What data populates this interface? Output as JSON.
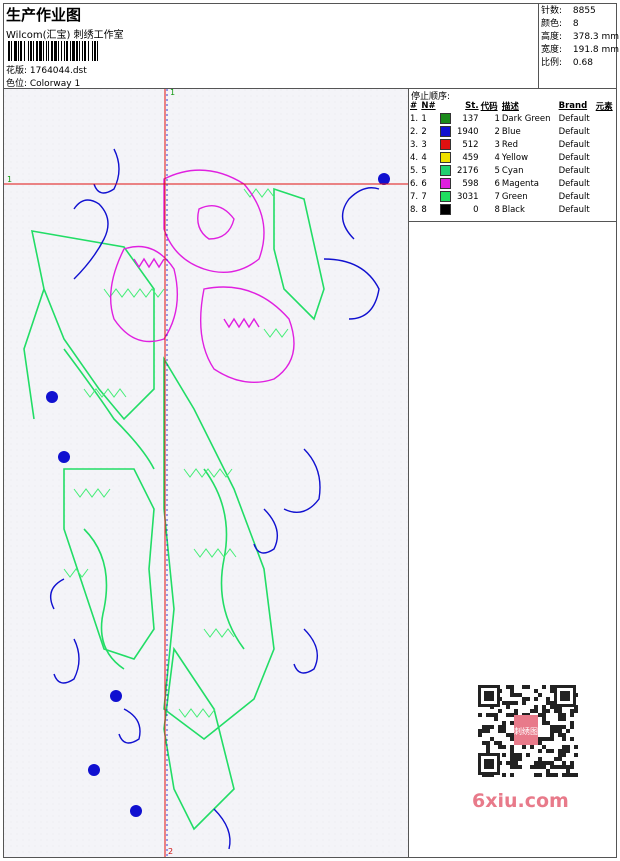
{
  "header": {
    "title": "生产作业图",
    "company": "Wilcom(汇宝) 刺绣工作室",
    "pattern": "花版:  1764044.dst",
    "colorway": "色位:  Colorway 1"
  },
  "stats": [
    {
      "label": "针数:",
      "value": "8855"
    },
    {
      "label": "颜色:",
      "value": "8"
    },
    {
      "label": "高度:",
      "value": "378.3 mm"
    },
    {
      "label": "宽度:",
      "value": "191.8 mm"
    },
    {
      "label": "比例:",
      "value": "0.68"
    }
  ],
  "stop_sequence": {
    "title": "停止顺序:",
    "columns": [
      "#",
      "N#",
      "St.",
      "代码",
      "描述",
      "Brand",
      "元素"
    ],
    "rows": [
      {
        "n": "1.",
        "nn": "1",
        "color": "#1a8a1a",
        "st": "137",
        "code": "1",
        "desc": "Dark Green",
        "brand": "Default"
      },
      {
        "n": "2.",
        "nn": "2",
        "color": "#1010d0",
        "st": "1940",
        "code": "2",
        "desc": "Blue",
        "brand": "Default"
      },
      {
        "n": "3.",
        "nn": "3",
        "color": "#e01010",
        "st": "512",
        "code": "3",
        "desc": "Red",
        "brand": "Default"
      },
      {
        "n": "4.",
        "nn": "4",
        "color": "#f0e000",
        "st": "459",
        "code": "4",
        "desc": "Yellow",
        "brand": "Default"
      },
      {
        "n": "5.",
        "nn": "5",
        "color": "#20d070",
        "st": "2176",
        "code": "5",
        "desc": "Cyan",
        "brand": "Default"
      },
      {
        "n": "6.",
        "nn": "6",
        "color": "#e020e0",
        "st": "598",
        "code": "6",
        "desc": "Magenta",
        "brand": "Default"
      },
      {
        "n": "7.",
        "nn": "7",
        "color": "#20e060",
        "st": "3031",
        "code": "7",
        "desc": "Green",
        "brand": "Default"
      },
      {
        "n": "8.",
        "nn": "8",
        "color": "#000000",
        "st": "0",
        "code": "8",
        "desc": "Black",
        "brand": "Default"
      }
    ]
  },
  "design": {
    "axis_labels": [
      "1",
      "1",
      "2"
    ],
    "axis_color": "#e01010"
  },
  "watermark": {
    "text": "6xiu.com",
    "qr_stamp": "刺绣图"
  }
}
